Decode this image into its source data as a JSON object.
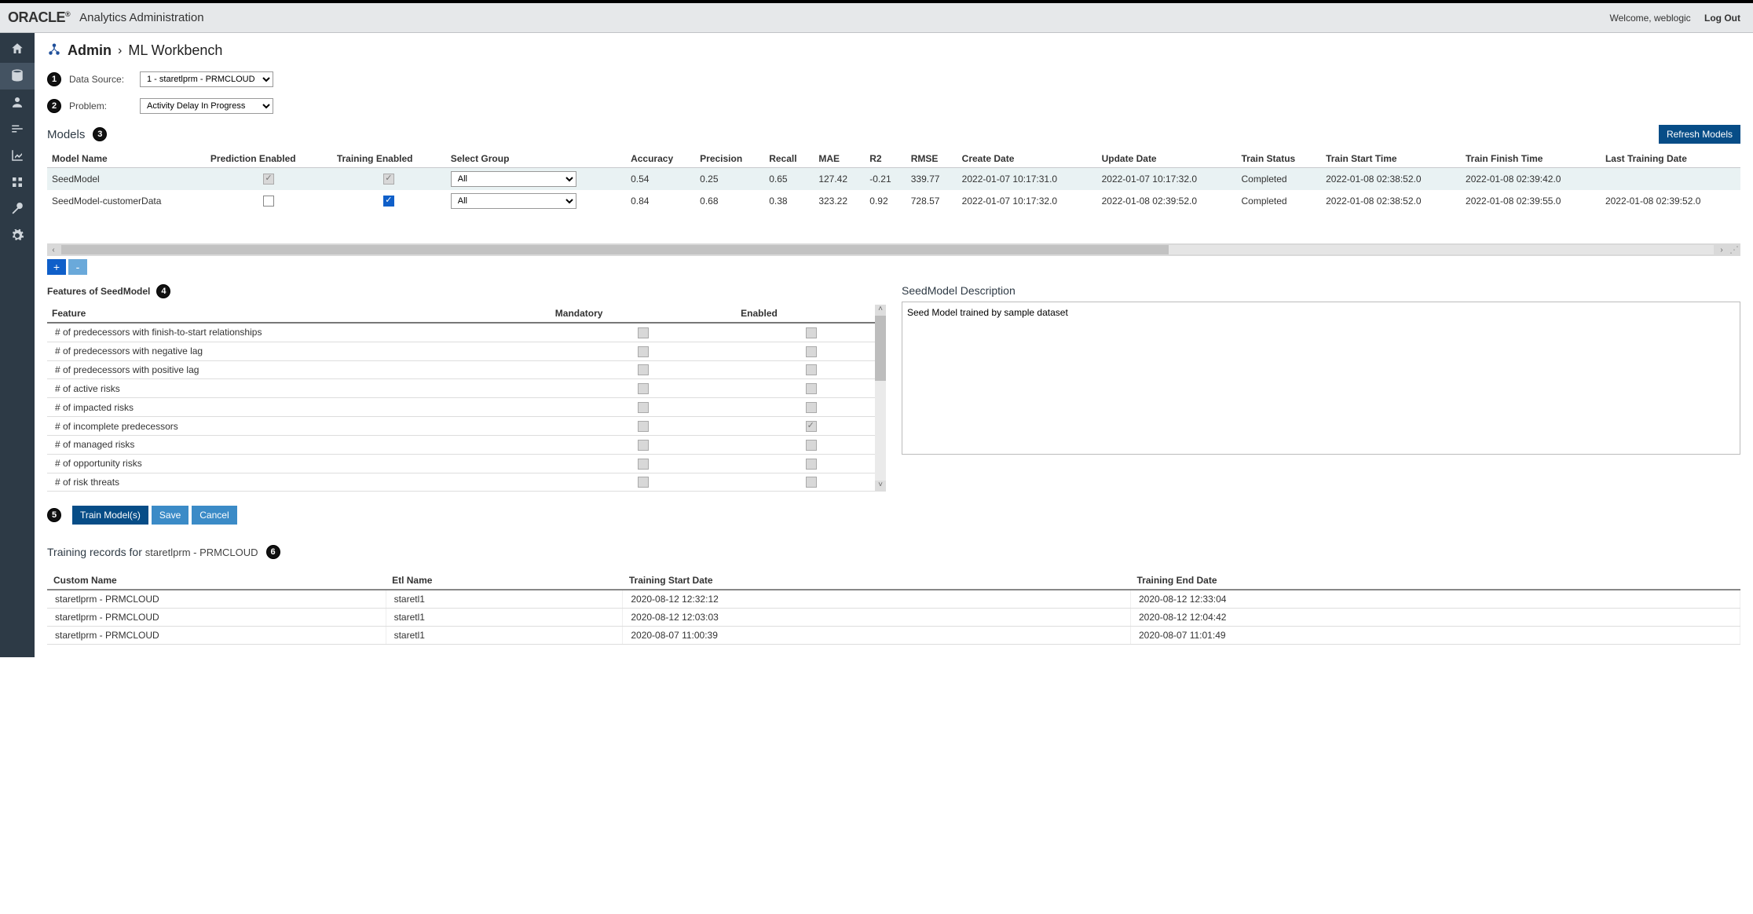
{
  "header": {
    "logo": "ORACLE",
    "app_title": "Analytics Administration",
    "welcome": "Welcome, weblogic",
    "logout": "Log Out"
  },
  "breadcrumb": {
    "admin": "Admin",
    "page": "ML Workbench"
  },
  "steps": {
    "data_source": "1",
    "problem": "2",
    "models": "3",
    "features": "4",
    "actions": "5",
    "training": "6"
  },
  "data_source": {
    "label": "Data Source:",
    "selected": "1 - staretlprm - PRMCLOUD"
  },
  "problem": {
    "label": "Problem:",
    "selected": "Activity Delay In Progress"
  },
  "models_section": {
    "title": "Models",
    "refresh_label": "Refresh Models",
    "columns": [
      "Model Name",
      "Prediction Enabled",
      "Training Enabled",
      "Select Group",
      "Accuracy",
      "Precision",
      "Recall",
      "MAE",
      "R2",
      "RMSE",
      "Create Date",
      "Update Date",
      "Train Status",
      "Train Start Time",
      "Train Finish Time",
      "Last Training Date"
    ],
    "rows": [
      {
        "name": "SeedModel",
        "prediction_enabled": {
          "checked": true,
          "disabled": true
        },
        "training_enabled": {
          "checked": true,
          "disabled": true
        },
        "select_group": "All",
        "accuracy": "0.54",
        "precision": "0.25",
        "recall": "0.65",
        "mae": "127.42",
        "r2": "-0.21",
        "rmse": "339.77",
        "create_date": "2022-01-07 10:17:31.0",
        "update_date": "2022-01-07 10:17:32.0",
        "train_status": "Completed",
        "train_start": "2022-01-08 02:38:52.0",
        "train_finish": "2022-01-08 02:39:42.0",
        "last_training": ""
      },
      {
        "name": "SeedModel-customerData",
        "prediction_enabled": {
          "checked": false,
          "disabled": false
        },
        "training_enabled": {
          "checked": true,
          "disabled": false
        },
        "select_group": "All",
        "accuracy": "0.84",
        "precision": "0.68",
        "recall": "0.38",
        "mae": "323.22",
        "r2": "0.92",
        "rmse": "728.57",
        "create_date": "2022-01-07 10:17:32.0",
        "update_date": "2022-01-08 02:39:52.0",
        "train_status": "Completed",
        "train_start": "2022-01-08 02:38:52.0",
        "train_finish": "2022-01-08 02:39:55.0",
        "last_training": "2022-01-08 02:39:52.0"
      }
    ],
    "add_label": "+",
    "remove_label": "-"
  },
  "features_section": {
    "title": "Features of SeedModel",
    "columns": [
      "Feature",
      "Mandatory",
      "Enabled"
    ],
    "rows": [
      {
        "feature": "# of predecessors with finish-to-start relationships",
        "mandatory": false,
        "enabled": false,
        "enabled_disabled": true
      },
      {
        "feature": "# of predecessors with negative lag",
        "mandatory": false,
        "enabled": false,
        "enabled_disabled": true
      },
      {
        "feature": "# of predecessors with positive lag",
        "mandatory": false,
        "enabled": false,
        "enabled_disabled": true
      },
      {
        "feature": "# of active risks",
        "mandatory": false,
        "enabled": false,
        "enabled_disabled": true
      },
      {
        "feature": "# of impacted risks",
        "mandatory": false,
        "enabled": false,
        "enabled_disabled": true
      },
      {
        "feature": "# of incomplete predecessors",
        "mandatory": false,
        "enabled": true,
        "enabled_disabled": true
      },
      {
        "feature": "# of managed risks",
        "mandatory": false,
        "enabled": false,
        "enabled_disabled": true
      },
      {
        "feature": "# of opportunity risks",
        "mandatory": false,
        "enabled": false,
        "enabled_disabled": true
      },
      {
        "feature": "# of risk threats",
        "mandatory": false,
        "enabled": false,
        "enabled_disabled": true
      }
    ]
  },
  "description": {
    "title": "SeedModel Description",
    "text": "Seed Model trained by sample dataset"
  },
  "actions": {
    "train": "Train Model(s)",
    "save": "Save",
    "cancel": "Cancel"
  },
  "training_records": {
    "title_prefix": "Training records for ",
    "title_name": "staretlprm - PRMCLOUD",
    "columns": [
      "Custom Name",
      "Etl Name",
      "Training Start Date",
      "Training End Date"
    ],
    "rows": [
      {
        "custom": "staretlprm - PRMCLOUD",
        "etl": "staretl1",
        "start": "2020-08-12 12:32:12",
        "end": "2020-08-12 12:33:04"
      },
      {
        "custom": "staretlprm - PRMCLOUD",
        "etl": "staretl1",
        "start": "2020-08-12 12:03:03",
        "end": "2020-08-12 12:04:42"
      },
      {
        "custom": "staretlprm - PRMCLOUD",
        "etl": "staretl1",
        "start": "2020-08-07 11:00:39",
        "end": "2020-08-07 11:01:49"
      }
    ]
  }
}
